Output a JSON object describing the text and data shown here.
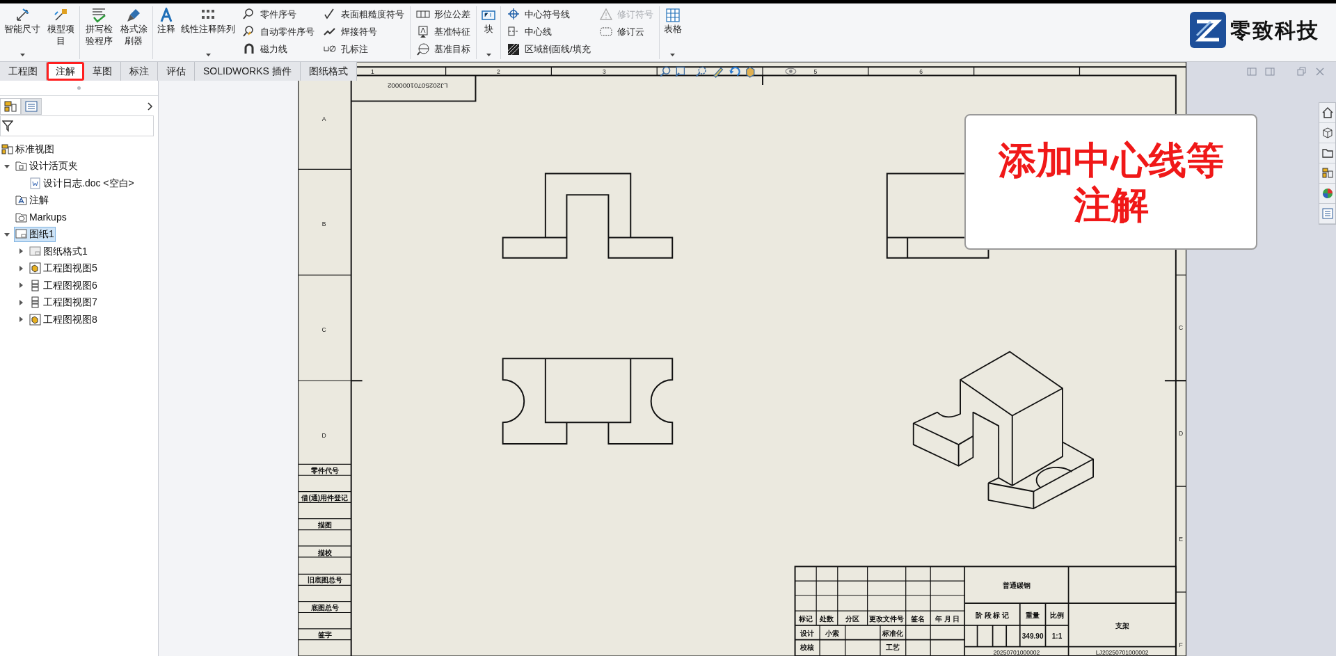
{
  "ribbon": {
    "groups": [
      {
        "items": [
          {
            "kind": "large",
            "label": "智能尺寸",
            "dropdown": true
          },
          {
            "kind": "large",
            "label": "模型项目",
            "dropdown": false
          }
        ]
      },
      {
        "items": [
          {
            "kind": "large",
            "label": "拼写检验程序",
            "dropdown": false
          },
          {
            "kind": "large",
            "label": "格式涂刷器",
            "dropdown": false
          }
        ]
      },
      {
        "items": [
          {
            "kind": "large",
            "label": "注释",
            "dropdown": false
          },
          {
            "kind": "large",
            "label": "线性注释阵列",
            "dropdown": true
          },
          {
            "kind": "stack",
            "entries": [
              {
                "label": "零件序号",
                "disabled": false
              },
              {
                "label": "自动零件序号",
                "disabled": false
              },
              {
                "label": "磁力线",
                "disabled": false
              }
            ]
          },
          {
            "kind": "stack",
            "entries": [
              {
                "label": "表面粗糙度符号",
                "disabled": false
              },
              {
                "label": "焊接符号",
                "disabled": false
              },
              {
                "label": "孔标注",
                "disabled": false
              }
            ]
          }
        ]
      },
      {
        "items": [
          {
            "kind": "stack",
            "entries": [
              {
                "label": "形位公差",
                "disabled": false
              },
              {
                "label": "基准特征",
                "disabled": false
              },
              {
                "label": "基准目标",
                "disabled": false
              }
            ]
          }
        ]
      },
      {
        "items": [
          {
            "kind": "large",
            "label": "块",
            "dropdown": true
          }
        ]
      },
      {
        "items": [
          {
            "kind": "stack",
            "entries": [
              {
                "label": "中心符号线",
                "disabled": false
              },
              {
                "label": "中心线",
                "disabled": false
              },
              {
                "label": "区域剖面线/填充",
                "disabled": false
              }
            ]
          },
          {
            "kind": "stack",
            "entries": [
              {
                "label": "修订符号",
                "disabled": true
              },
              {
                "label": "修订云",
                "disabled": false
              }
            ]
          }
        ]
      },
      {
        "items": [
          {
            "kind": "large",
            "label": "表格",
            "dropdown": true
          }
        ]
      }
    ]
  },
  "logo": {
    "text": "零致科技"
  },
  "tabs": [
    {
      "label": "工程图",
      "selected": false
    },
    {
      "label": "注解",
      "selected": true
    },
    {
      "label": "草图",
      "selected": false
    },
    {
      "label": "标注",
      "selected": false
    },
    {
      "label": "评估",
      "selected": false
    },
    {
      "label": "SOLIDWORKS 插件",
      "selected": false
    },
    {
      "label": "图纸格式",
      "selected": false
    }
  ],
  "tree": [
    {
      "kind": "views",
      "label": "标准视图",
      "selected": false
    },
    {
      "kind": "binder",
      "label": "设计活页夹",
      "selected": false,
      "expanded": true,
      "children": [
        {
          "kind": "doc",
          "label": "设计日志.doc <空白>",
          "selected": false
        }
      ]
    },
    {
      "kind": "notes",
      "label": "注解",
      "selected": false
    },
    {
      "kind": "markups",
      "label": "Markups",
      "selected": false
    },
    {
      "kind": "sheet",
      "label": "图纸1",
      "selected": true,
      "expanded": true,
      "children": [
        {
          "kind": "format",
          "label": "图纸格式1",
          "selected": false,
          "expanded": false
        },
        {
          "kind": "model-view",
          "label": "工程图视图5",
          "selected": false,
          "expanded": false
        },
        {
          "kind": "projected-view",
          "label": "工程图视图6",
          "selected": false,
          "expanded": false
        },
        {
          "kind": "projected-view",
          "label": "工程图视图7",
          "selected": false,
          "expanded": false
        },
        {
          "kind": "model-view",
          "label": "工程图视图8",
          "selected": false,
          "expanded": false
        }
      ]
    }
  ],
  "sheet": {
    "top_zones": [
      "1",
      "2",
      "3",
      "5",
      "6"
    ],
    "left_zones": [
      "A",
      "B",
      "C",
      "D"
    ],
    "right_zones": [
      "C",
      "D",
      "E",
      "F"
    ],
    "upside_down_number": "LJ20250701000002",
    "side_labels": [
      "零件代号",
      "借(通)用件登记",
      "描图",
      "描校",
      "旧底图总号",
      "底图总号",
      "签字"
    ],
    "title_block": {
      "header": [
        "标记",
        "处数",
        "分区",
        "更改文件号",
        "签名",
        "年 月 日"
      ],
      "sign_rows": [
        {
          "role": "设计",
          "name": "小索",
          "check_role": "标准化"
        },
        {
          "role": "校核",
          "check_role": "工艺"
        }
      ],
      "material": "普通碳钢",
      "stage_label": "阶 段 标 记",
      "weight_label": "重量",
      "scale_label": "比例",
      "weight": "349.90",
      "scale": "1:1",
      "part_name": "支架",
      "code": "20250701000002",
      "drawing_number": "LJ20250701000002"
    }
  },
  "callout": {
    "text": "添加中心线等注解"
  }
}
